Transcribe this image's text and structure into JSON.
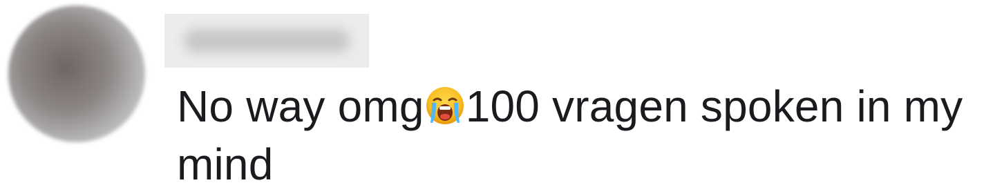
{
  "comment": {
    "username": "",
    "text_before_emoji": "No way omg",
    "emoji": "loudly-crying-face-emoji",
    "text_after_emoji_line1": "100 vragen spoken in my",
    "text_line2": "mind"
  },
  "colors": {
    "text": "#1a1a1f",
    "background": "#ffffff",
    "username_blur": "#ececec"
  }
}
